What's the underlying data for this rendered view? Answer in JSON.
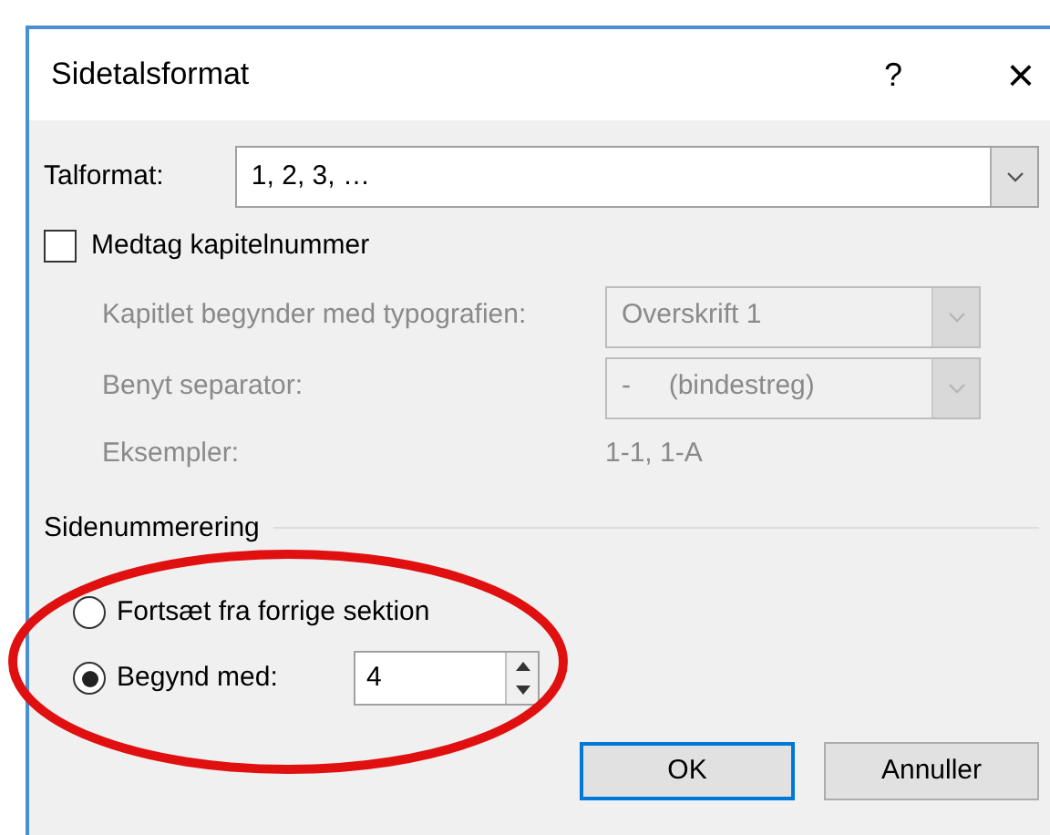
{
  "window": {
    "title": "Sidetalsformat",
    "help": "?",
    "close": "×"
  },
  "number_format": {
    "label": "Talformat:",
    "value": "1, 2, 3, …"
  },
  "include_chapter": {
    "label": "Medtag kapitelnummer",
    "checked": false
  },
  "chapter_rows": [
    {
      "kind": "select",
      "label": "Kapitlet begynder med typografien:",
      "value": "Overskrift 1",
      "disabled": true
    },
    {
      "kind": "select",
      "label": "Benyt separator:",
      "value": "-     (bindestreg)",
      "disabled": true
    },
    {
      "kind": "text",
      "label": "Eksempler:",
      "value": "1-1, 1-A",
      "disabled": true
    }
  ],
  "page_numbering": {
    "label": "Sidenummerering",
    "options": [
      {
        "kind": "plain",
        "label": "Fortsæt fra forrige sektion",
        "selected": false
      },
      {
        "kind": "spin",
        "label": "Begynd med:",
        "value": "4",
        "selected": true
      }
    ]
  },
  "buttons": [
    {
      "label": "OK",
      "default": true
    },
    {
      "label": "Annuller",
      "default": false
    }
  ]
}
